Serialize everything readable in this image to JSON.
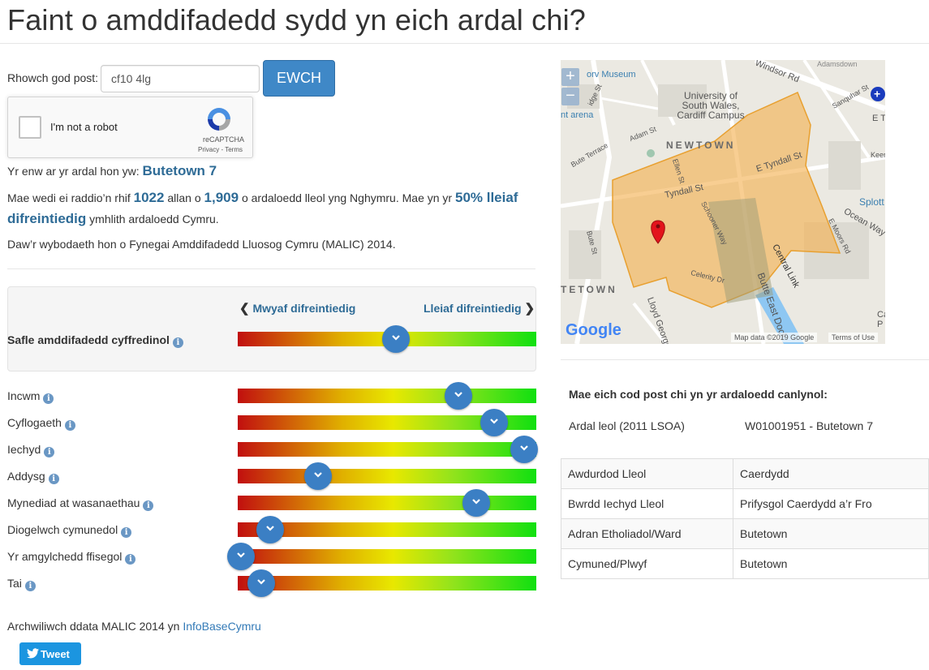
{
  "page": {
    "title": "Faint o amddifadedd sydd yn eich ardal chi?"
  },
  "search": {
    "label": "Rhowch god post:",
    "value": "cf10 4lg",
    "button": "EWCH"
  },
  "captcha": {
    "label": "I'm not a robot",
    "brand": "reCAPTCHA",
    "links": "Privacy - Terms"
  },
  "summary": {
    "area_prefix": "Yr enw ar yr ardal hon yw:",
    "area_name": "Butetown 7",
    "rank_text_1": "Mae wedi ei raddio’n rhif",
    "rank": "1022",
    "rank_text_2": "allan o",
    "total": "1,909",
    "rank_text_3": "o ardaloedd lleol yng Nghymru. Mae yn yr",
    "band": "50% lleiaf difreintiedig",
    "rank_text_4": "ymhlith ardaloedd Cymru.",
    "source": "Daw’r wybodaeth hon o Fynegai Amddifadedd Lluosog Cymru (MALIC) 2014."
  },
  "scale": {
    "most_label": "Mwyaf difreintiedig",
    "least_label": "Lleiaf difreintiedig",
    "colors": [
      "#c10f0f",
      "#e0b000",
      "#e8e800",
      "#92e31c",
      "#10e010"
    ]
  },
  "overall": {
    "label": "Safle amddifadedd cyffredinol",
    "position": 0.53
  },
  "domains": [
    {
      "label": "Incwm",
      "position": 0.74
    },
    {
      "label": "Cyflogaeth",
      "position": 0.86
    },
    {
      "label": "Iechyd",
      "position": 0.96
    },
    {
      "label": "Addysg",
      "position": 0.27
    },
    {
      "label": "Mynediad at wasanaethau",
      "position": 0.8
    },
    {
      "label": "Diogelwch cymunedol",
      "position": 0.11
    },
    {
      "label": "Yr amgylchedd ffisegol",
      "position": 0.01
    },
    {
      "label": "Tai",
      "position": 0.08
    }
  ],
  "explore": {
    "text": "Archwiliwch ddata MALIC 2014 yn",
    "link": "InfoBaseCymru"
  },
  "tweet": "Tweet",
  "map": {
    "zoom_in": "+",
    "zoom_out": "−",
    "labels": [
      "Windsor Rd",
      "University of South Wales, Cardiff Campus",
      "NEWTOWN",
      "E Tyndall St",
      "Tyndall St",
      "Splott",
      "Ocean Way",
      "Sanquhar St",
      "Adam St",
      "Bute Terrace",
      "Bute St",
      "TETOWN",
      "Lloyd George",
      "Central Link",
      "Butte East Dock",
      "Schooner Way",
      "Celerity Dr",
      "Ellen St",
      "E Moors Rd",
      "Keen",
      "E T",
      "orv Museum",
      "nt arena",
      "idge St",
      "Ca P"
    ],
    "attribution": "Map data ©2019 Google",
    "terms": "Terms of Use",
    "google": "Google"
  },
  "results": {
    "heading": "Mae eich cod post chi yn yr ardaloedd canlynol:",
    "lsoa_label": "Ardal leol (2011 LSOA)",
    "lsoa_value": "W01001951 - Butetown 7",
    "rows": [
      {
        "key": "Awdurdod Lleol",
        "value": "Caerdydd"
      },
      {
        "key": "Bwrdd Iechyd Lleol",
        "value": "Prifysgol Caerdydd a’r Fro"
      },
      {
        "key": "Adran Etholiadol/Ward",
        "value": "Butetown"
      },
      {
        "key": "Cymuned/Plwyf",
        "value": "Butetown"
      }
    ]
  }
}
